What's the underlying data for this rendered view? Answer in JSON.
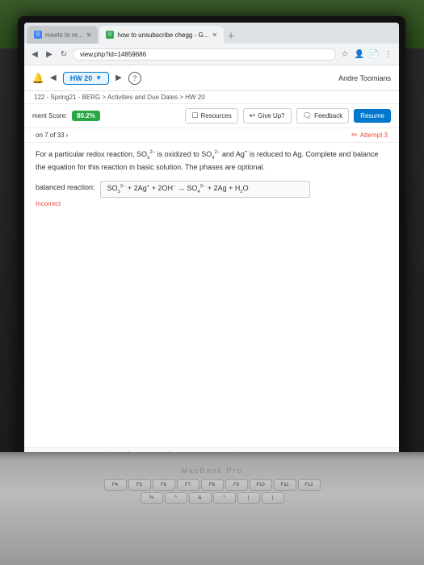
{
  "browser": {
    "tabs": [
      {
        "id": "tab1",
        "label": "meets to re...",
        "active": false,
        "favicon": "blue"
      },
      {
        "id": "tab2",
        "label": "how to unsubscribe chegg - G...",
        "active": true,
        "favicon": "green"
      }
    ],
    "address": "view.php?id=14859686"
  },
  "chegg_header": {
    "hw_label": "HW 20",
    "user_name": "Andre Toomians"
  },
  "breadcrumb": {
    "path": "122 - Spring21 - BERG  >  Activities and Due Dates  >  HW 20"
  },
  "toolbar": {
    "score_label": "ment Score:",
    "score_value": "80.2%",
    "question_nav": "on 7 of 33",
    "resources_label": "Resources",
    "give_up_label": "Give Up?",
    "feedback_label": "Feedback",
    "resume_label": "Resume",
    "attempt_label": "Attempt 3"
  },
  "question": {
    "text_part1": "For a particular redox reaction, SO",
    "text_sup1": "2−",
    "text_sub1": "3",
    "text_part2": " is oxidized to SO",
    "text_sup2": "2−",
    "text_sub2": "4",
    "text_part3": " and Ag",
    "text_sup3": "+",
    "text_part4": " is reduced to Ag. Complete and balance the equation for this reaction in basic solution. The phases are optional.",
    "reaction_prefix": "balanced reaction:",
    "reaction_formula": "SO₃²⁻ + 2Ag⁺ + 2OH⁻ → SO₄²⁻ + 2Ag + H₂O",
    "incorrect_label": "Incorrect"
  },
  "footer": {
    "links": [
      "about us",
      "careers",
      "privacy policy",
      "terms of use",
      "contact us",
      "help"
    ]
  },
  "keyboard": {
    "label": "MacBook Pro",
    "rows": [
      [
        "F4",
        "F5",
        "F6",
        "F7",
        "F8",
        "F9",
        "F10",
        "F11",
        "F12"
      ],
      [
        "%",
        "^",
        "&",
        "*",
        "(",
        ")"
      ]
    ]
  }
}
